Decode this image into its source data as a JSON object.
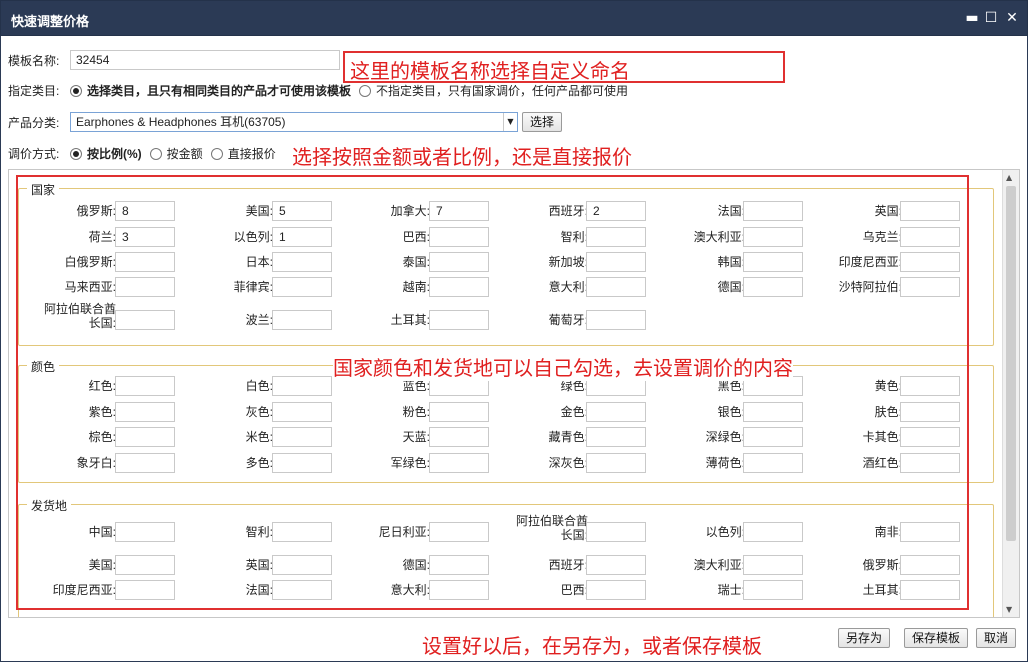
{
  "window": {
    "title": "快速调整价格",
    "min_icon": "▬",
    "max_icon": "☐",
    "close_icon": "✕"
  },
  "template": {
    "label": "模板名称:",
    "value": "32454"
  },
  "category_mode": {
    "label": "指定类目:",
    "options": [
      {
        "label": "选择类目，且只有相同类目的产品才可使用该模板",
        "selected": true
      },
      {
        "label": "不指定类目，只有国家调价，任何产品都可使用",
        "selected": false
      }
    ]
  },
  "product_category": {
    "label": "产品分类:",
    "value": "Earphones & Headphones 耳机(63705)",
    "select_button": "选择"
  },
  "adjust_mode": {
    "label": "调价方式:",
    "options": [
      {
        "label": "按比例(%)",
        "selected": true
      },
      {
        "label": "按金额",
        "selected": false
      },
      {
        "label": "直接报价",
        "selected": false
      }
    ]
  },
  "annotations": {
    "a1": "这里的模板名称选择自定义命名",
    "a2": "选择按照金额或者比例，还是直接报价",
    "a3": "国家颜色和发货地可以自己勾选，去设置调价的内容",
    "a4": "设置好以后，在另存为，或者保存模板"
  },
  "groups": {
    "country": {
      "title": "国家",
      "rows": [
        [
          {
            "l": "俄罗斯:",
            "v": "8"
          },
          {
            "l": "美国:",
            "v": "5"
          },
          {
            "l": "加拿大:",
            "v": "7"
          },
          {
            "l": "西班牙:",
            "v": "2"
          },
          {
            "l": "法国:",
            "v": ""
          },
          {
            "l": "英国:",
            "v": ""
          }
        ],
        [
          {
            "l": "荷兰:",
            "v": "3"
          },
          {
            "l": "以色列:",
            "v": "1"
          },
          {
            "l": "巴西:",
            "v": ""
          },
          {
            "l": "智利:",
            "v": ""
          },
          {
            "l": "澳大利亚:",
            "v": ""
          },
          {
            "l": "乌克兰:",
            "v": ""
          }
        ],
        [
          {
            "l": "白俄罗斯:",
            "v": ""
          },
          {
            "l": "日本:",
            "v": ""
          },
          {
            "l": "泰国:",
            "v": ""
          },
          {
            "l": "新加坡:",
            "v": ""
          },
          {
            "l": "韩国:",
            "v": ""
          },
          {
            "l": "印度尼西亚:",
            "v": ""
          }
        ],
        [
          {
            "l": "马来西亚:",
            "v": ""
          },
          {
            "l": "菲律宾:",
            "v": ""
          },
          {
            "l": "越南:",
            "v": ""
          },
          {
            "l": "意大利:",
            "v": ""
          },
          {
            "l": "德国:",
            "v": ""
          },
          {
            "l": "沙特阿拉伯:",
            "v": ""
          }
        ],
        [
          {
            "l": "阿拉伯联合酋长国:",
            "v": ""
          },
          {
            "l": "波兰:",
            "v": ""
          },
          {
            "l": "土耳其:",
            "v": ""
          },
          {
            "l": "葡萄牙:",
            "v": ""
          }
        ]
      ]
    },
    "color": {
      "title": "颜色",
      "rows": [
        [
          {
            "l": "红色:",
            "v": ""
          },
          {
            "l": "白色:",
            "v": ""
          },
          {
            "l": "蓝色:",
            "v": ""
          },
          {
            "l": "绿色:",
            "v": ""
          },
          {
            "l": "黑色:",
            "v": ""
          },
          {
            "l": "黄色:",
            "v": ""
          }
        ],
        [
          {
            "l": "紫色:",
            "v": ""
          },
          {
            "l": "灰色:",
            "v": ""
          },
          {
            "l": "粉色:",
            "v": ""
          },
          {
            "l": "金色:",
            "v": ""
          },
          {
            "l": "银色:",
            "v": ""
          },
          {
            "l": "肤色:",
            "v": ""
          }
        ],
        [
          {
            "l": "棕色:",
            "v": ""
          },
          {
            "l": "米色:",
            "v": ""
          },
          {
            "l": "天蓝:",
            "v": ""
          },
          {
            "l": "藏青色:",
            "v": ""
          },
          {
            "l": "深绿色:",
            "v": ""
          },
          {
            "l": "卡其色:",
            "v": ""
          }
        ],
        [
          {
            "l": "象牙白:",
            "v": ""
          },
          {
            "l": "多色:",
            "v": ""
          },
          {
            "l": "军绿色:",
            "v": ""
          },
          {
            "l": "深灰色:",
            "v": ""
          },
          {
            "l": "薄荷色:",
            "v": ""
          },
          {
            "l": "酒红色:",
            "v": ""
          }
        ]
      ]
    },
    "ship_from": {
      "title": "发货地",
      "rows": [
        [
          {
            "l": "中国:",
            "v": ""
          },
          {
            "l": "智利:",
            "v": ""
          },
          {
            "l": "尼日利亚:",
            "v": ""
          },
          {
            "l": "阿拉伯联合酋长国:",
            "v": ""
          },
          {
            "l": "以色列:",
            "v": ""
          },
          {
            "l": "南非:",
            "v": ""
          }
        ],
        [
          {
            "l": "美国:",
            "v": ""
          },
          {
            "l": "英国:",
            "v": ""
          },
          {
            "l": "德国:",
            "v": ""
          },
          {
            "l": "西班牙:",
            "v": ""
          },
          {
            "l": "澳大利亚:",
            "v": ""
          },
          {
            "l": "俄罗斯:",
            "v": ""
          }
        ],
        [
          {
            "l": "印度尼西亚:",
            "v": ""
          },
          {
            "l": "法国:",
            "v": ""
          },
          {
            "l": "意大利:",
            "v": ""
          },
          {
            "l": "巴西:",
            "v": ""
          },
          {
            "l": "瑞士:",
            "v": ""
          },
          {
            "l": "土耳其:",
            "v": ""
          }
        ]
      ]
    }
  },
  "footer": {
    "save_as": "另存为",
    "save_template": "保存模板",
    "cancel": "取消"
  }
}
